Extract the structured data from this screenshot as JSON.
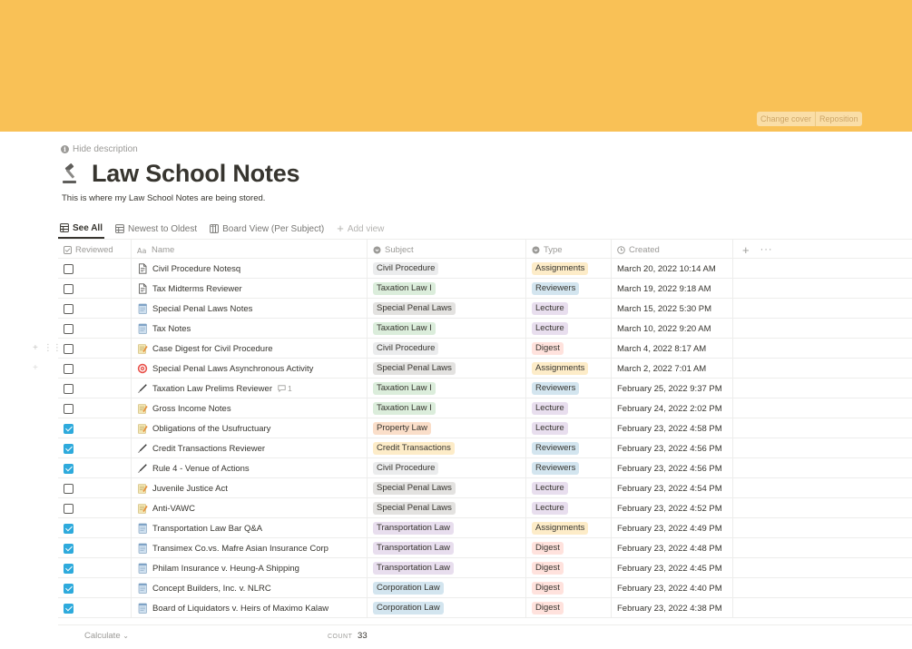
{
  "cover": {
    "color": "#f9c156",
    "change_label": "Change cover",
    "reposition_label": "Reposition"
  },
  "page": {
    "hide_description": "Hide description",
    "title": "Law School Notes",
    "description": "This is where my Law School Notes are being stored."
  },
  "views": [
    {
      "label": "See All",
      "icon": "table-icon",
      "active": true
    },
    {
      "label": "Newest to Oldest",
      "icon": "table-icon",
      "active": false
    },
    {
      "label": "Board View (Per Subject)",
      "icon": "board-icon",
      "active": false
    }
  ],
  "add_view_label": "Add view",
  "columns": {
    "reviewed": "Reviewed",
    "name": "Name",
    "subject": "Subject",
    "type": "Type",
    "created": "Created"
  },
  "tag_colors": {
    "Civil Procedure": "#ebeced",
    "Taxation Law I": "#dbeddb",
    "Special Penal Laws": "#e3e2e0",
    "Property Law": "#fadec9",
    "Credit Transactions": "#fdecc8",
    "Transportation Law": "#e8deee",
    "Corporation Law": "#d3e5ef",
    "Assignments": "#fdecc8",
    "Reviewers": "#d3e5ef",
    "Lecture": "#e8deee",
    "Digest": "#ffe2dd"
  },
  "rows": [
    {
      "reviewed": false,
      "icon": "document-icon",
      "name": "Civil Procedure Notesq",
      "subject": "Civil Procedure",
      "type": "Assignments",
      "created": "March 20, 2022 10:14 AM"
    },
    {
      "reviewed": false,
      "icon": "document-icon",
      "name": "Tax Midterms Reviewer",
      "subject": "Taxation Law I",
      "type": "Reviewers",
      "created": "March 19, 2022 9:18 AM"
    },
    {
      "reviewed": false,
      "icon": "notepad-icon",
      "name": "Special Penal Laws Notes",
      "subject": "Special Penal Laws",
      "type": "Lecture",
      "created": "March 15, 2022 5:30 PM"
    },
    {
      "reviewed": false,
      "icon": "notepad-icon",
      "name": "Tax Notes",
      "subject": "Taxation Law I",
      "type": "Lecture",
      "created": "March 10, 2022 9:20 AM"
    },
    {
      "reviewed": false,
      "icon": "memo-icon",
      "name": "Case Digest for Civil Procedure",
      "subject": "Civil Procedure",
      "type": "Digest",
      "created": "March 4, 2022 8:17 AM"
    },
    {
      "reviewed": false,
      "icon": "target-icon",
      "name": "Special Penal Laws Asynchronous Activity",
      "subject": "Special Penal Laws",
      "type": "Assignments",
      "created": "March 2, 2022 7:01 AM"
    },
    {
      "reviewed": false,
      "icon": "pen-icon",
      "name": "Taxation Law Prelims Reviewer",
      "comment": "1",
      "subject": "Taxation Law I",
      "type": "Reviewers",
      "created": "February 25, 2022 9:37 PM"
    },
    {
      "reviewed": false,
      "icon": "memo-icon",
      "name": "Gross Income Notes",
      "subject": "Taxation Law I",
      "type": "Lecture",
      "created": "February 24, 2022 2:02 PM"
    },
    {
      "reviewed": true,
      "icon": "memo-icon",
      "name": "Obligations of the Usufructuary",
      "subject": "Property Law",
      "type": "Lecture",
      "created": "February 23, 2022 4:58 PM"
    },
    {
      "reviewed": true,
      "icon": "pen-icon",
      "name": "Credit Transactions Reviewer",
      "subject": "Credit Transactions",
      "type": "Reviewers",
      "created": "February 23, 2022 4:56 PM"
    },
    {
      "reviewed": true,
      "icon": "pen-icon",
      "name": "Rule 4 - Venue of Actions",
      "subject": "Civil Procedure",
      "type": "Reviewers",
      "created": "February 23, 2022 4:56 PM"
    },
    {
      "reviewed": false,
      "icon": "memo-icon",
      "name": "Juvenile Justice Act",
      "subject": "Special Penal Laws",
      "type": "Lecture",
      "created": "February 23, 2022 4:54 PM"
    },
    {
      "reviewed": false,
      "icon": "memo-icon",
      "name": "Anti-VAWC",
      "subject": "Special Penal Laws",
      "type": "Lecture",
      "created": "February 23, 2022 4:52 PM"
    },
    {
      "reviewed": true,
      "icon": "notepad-icon",
      "name": "Transportation Law Bar Q&A",
      "subject": "Transportation Law",
      "type": "Assignments",
      "created": "February 23, 2022 4:49 PM"
    },
    {
      "reviewed": true,
      "icon": "notepad-icon",
      "name": "Transimex Co.vs. Mafre Asian Insurance Corp",
      "subject": "Transportation Law",
      "type": "Digest",
      "created": "February 23, 2022 4:48 PM"
    },
    {
      "reviewed": true,
      "icon": "notepad-icon",
      "name": "Philam Insurance v. Heung-A Shipping",
      "subject": "Transportation Law",
      "type": "Digest",
      "created": "February 23, 2022 4:45 PM"
    },
    {
      "reviewed": true,
      "icon": "notepad-icon",
      "name": "Concept Builders, Inc. v. NLRC",
      "subject": "Corporation Law",
      "type": "Digest",
      "created": "February 23, 2022 4:40 PM"
    },
    {
      "reviewed": true,
      "icon": "notepad-icon",
      "name": "Board of Liquidators v. Heirs of Maximo Kalaw",
      "subject": "Corporation Law",
      "type": "Digest",
      "created": "February 23, 2022 4:38 PM"
    }
  ],
  "footer": {
    "calculate_label": "Calculate",
    "count_label": "COUNT",
    "count_value": "33"
  }
}
